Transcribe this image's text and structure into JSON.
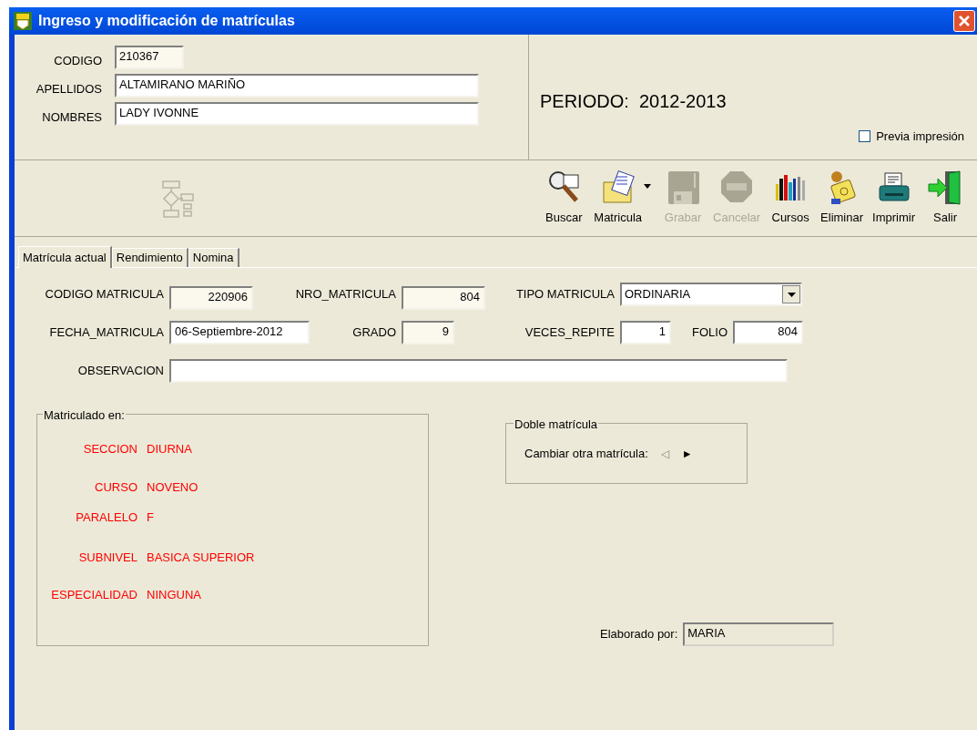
{
  "window": {
    "title": "Ingreso y modificación de matrículas"
  },
  "student": [
    {
      "label": "CODIGO",
      "value": "210367",
      "readonly": true
    },
    {
      "label": "APELLIDOS",
      "value": "ALTAMIRANO MARIÑO",
      "readonly": false
    },
    {
      "label": "NOMBRES",
      "value": "LADY IVONNE",
      "readonly": false
    }
  ],
  "periodo": "PERIODO:  2012-2013",
  "preview": {
    "label": "Previa impresión",
    "checked": false
  },
  "toolbar": [
    {
      "label": "Buscar",
      "disabled": false,
      "kind": "button"
    },
    {
      "label": "Matricula",
      "disabled": false,
      "kind": "dropdown"
    },
    {
      "label": "Grabar",
      "disabled": true,
      "kind": "button"
    },
    {
      "label": "Cancelar",
      "disabled": true,
      "kind": "button"
    },
    {
      "label": "Cursos",
      "disabled": false,
      "kind": "button"
    },
    {
      "label": "Eliminar",
      "disabled": false,
      "kind": "button"
    },
    {
      "label": "Imprimir",
      "disabled": false,
      "kind": "button"
    },
    {
      "label": "Salir",
      "disabled": false,
      "kind": "button"
    }
  ],
  "tabs": [
    {
      "label": "Matrícula actual",
      "selected": true
    },
    {
      "label": "Rendimiento",
      "selected": false
    },
    {
      "label": "Nomina",
      "selected": false
    }
  ],
  "fields": {
    "codigo_matricula": {
      "label": "CODIGO MATRICULA",
      "value": "220906"
    },
    "nro_matricula": {
      "label": "NRO_MATRICULA",
      "value": "804"
    },
    "tipo_matricula": {
      "label": "TIPO MATRICULA",
      "value": "ORDINARIA"
    },
    "fecha_matricula": {
      "label": "FECHA_MATRICULA",
      "value": "06-Septiembre-2012"
    },
    "grado": {
      "label": "GRADO",
      "value": "9"
    },
    "veces_repite": {
      "label": "VECES_REPITE",
      "value": "1"
    },
    "folio": {
      "label": "FOLIO",
      "value": "804"
    },
    "observacion": {
      "label": "OBSERVACION"
    }
  },
  "matriculado": {
    "title": "Matriculado en:",
    "items": [
      {
        "label": "SECCION",
        "value": "DIURNA"
      },
      {
        "label": "CURSO",
        "value": "NOVENO"
      },
      {
        "label": "PARALELO",
        "value": "F"
      },
      {
        "label": "SUBNIVEL",
        "value": "BASICA SUPERIOR"
      },
      {
        "label": "ESPECIALIDAD",
        "value": "NINGUNA"
      }
    ]
  },
  "doble": {
    "title": "Doble matrícula",
    "label": "Cambiar otra matrícula:",
    "nav": [
      {
        "symbol": "◁",
        "disabled": true
      },
      {
        "symbol": "►",
        "disabled": false
      }
    ]
  },
  "elaborado": {
    "label": "Elaborado por:",
    "value": "MARIA"
  }
}
